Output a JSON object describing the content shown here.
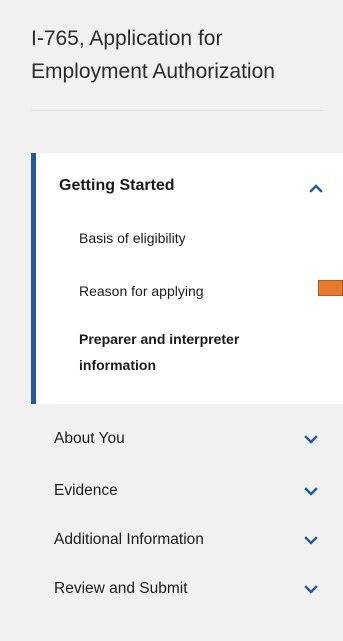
{
  "form_title": "I-765, Application for Employment Authorization",
  "active_section": {
    "label": "Getting Started",
    "expanded": true,
    "icon": "chevron-up-icon",
    "items": [
      {
        "label": "Basis of eligibility",
        "current": false
      },
      {
        "label": "Reason for applying",
        "current": false
      },
      {
        "label": "Preparer and interpreter information",
        "current": true
      }
    ]
  },
  "sections": [
    {
      "label": "About You",
      "icon": "chevron-down-icon"
    },
    {
      "label": "Evidence",
      "icon": "chevron-down-icon"
    },
    {
      "label": "Additional Information",
      "icon": "chevron-down-icon"
    },
    {
      "label": "Review and Submit",
      "icon": "chevron-down-icon"
    }
  ],
  "colors": {
    "active_border": "#1f5b9c",
    "chevron": "#1f5b9c",
    "marker": "#e87a2f",
    "background": "#f1f1f1"
  }
}
